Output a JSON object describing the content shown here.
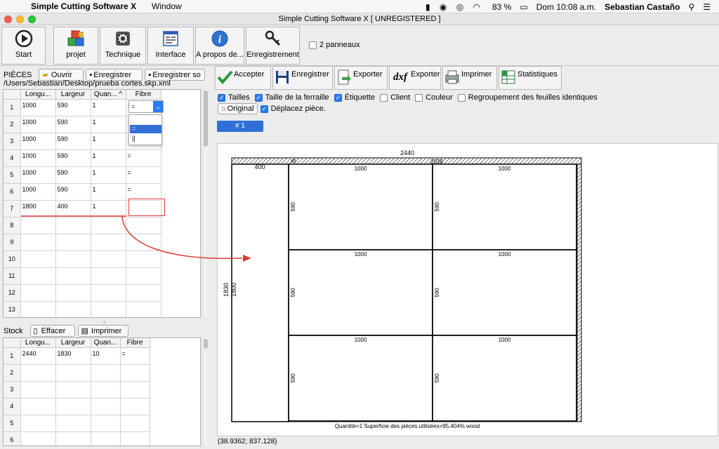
{
  "menubar": {
    "app_name": "Simple Cutting Software X",
    "menu_window": "Window",
    "battery": "83 %",
    "clock": "Dom 10:08 a.m.",
    "user": "Sebastian Castaño"
  },
  "window": {
    "title": "Simple Cutting Software X [ UNREGISTERED ]"
  },
  "toolbar": {
    "start": "Start",
    "projet": "projet",
    "technique": "Technique",
    "interface": "Interface",
    "apropos": "A propos de...",
    "enregistrement": "Enregistrement",
    "deux_panneaux": "2 panneaux"
  },
  "pieces": {
    "title": "PIÈCES",
    "open": "Ouvrir",
    "save": "Enregistrer",
    "save_as": "Enregistrer so",
    "path": "/Users/Sebastian/Desktop/prueba cortes.skp.xml",
    "columns": [
      "Longu...",
      "Largeur",
      "Quan... ^",
      "Fibre"
    ],
    "rows": [
      [
        "1",
        "1000",
        "590",
        "1",
        "="
      ],
      [
        "2",
        "1000",
        "590",
        "1",
        ""
      ],
      [
        "3",
        "1000",
        "590",
        "1",
        ""
      ],
      [
        "4",
        "1000",
        "590",
        "1",
        "="
      ],
      [
        "5",
        "1000",
        "590",
        "1",
        "="
      ],
      [
        "6",
        "1000",
        "590",
        "1",
        "="
      ],
      [
        "7",
        "1800",
        "400",
        "1",
        ""
      ],
      [
        "8",
        "",
        "",
        "",
        ""
      ],
      [
        "9",
        "",
        "",
        "",
        ""
      ],
      [
        "10",
        "",
        "",
        "",
        ""
      ],
      [
        "11",
        "",
        "",
        "",
        ""
      ],
      [
        "12",
        "",
        "",
        "",
        ""
      ],
      [
        "13",
        "",
        "",
        "",
        ""
      ]
    ],
    "dropdown_options": [
      "=",
      "||"
    ]
  },
  "stock": {
    "title": "Stock",
    "clear": "Effacer",
    "print": "Imprimer",
    "columns": [
      "Longu...",
      "Largeur",
      "Quan...",
      "Fibre"
    ],
    "rows": [
      [
        "1",
        "2440",
        "1830",
        "10",
        "="
      ],
      [
        "2",
        "",
        "",
        "",
        ""
      ],
      [
        "3",
        "",
        "",
        "",
        ""
      ],
      [
        "4",
        "",
        "",
        "",
        ""
      ],
      [
        "5",
        "",
        "",
        "",
        ""
      ],
      [
        "6",
        "",
        "",
        "",
        ""
      ]
    ]
  },
  "actions": {
    "accept": "Accepter",
    "save": "Enregistrer",
    "export": "Exporter",
    "export_dxf": "Exporter",
    "dxf_label": "dxf",
    "print": "Imprimer",
    "stats": "Statistiques"
  },
  "options": {
    "tailles": "Tailles",
    "ferraille": "Taille de la ferraille",
    "etiquette": "Étiquette",
    "client": "Client",
    "couleur": "Couleur",
    "regroupement": "Regroupement des feuilles identiques",
    "original": "Original",
    "deplacez": "Déplacez pièce.",
    "sheet_tab": "# 1"
  },
  "layout_labels": {
    "sheet_width": "2440",
    "sheet_height": "1830",
    "inner_height": "1800",
    "strip_width": "400",
    "top_small": "45",
    "top_width": "2036",
    "piece_w": "1000",
    "piece_h": "590",
    "summary": "Quantité=1 Superficie des pièces utilisées=95.404%  wood"
  },
  "status": {
    "coords": "(38.9362; 837.128)"
  }
}
